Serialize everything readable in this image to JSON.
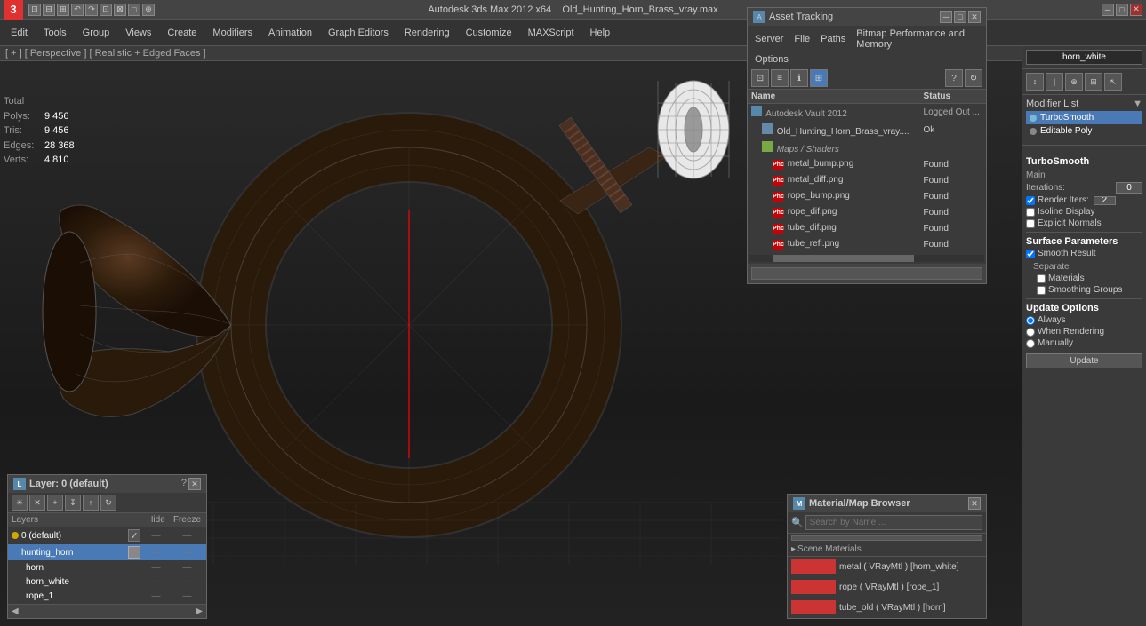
{
  "app": {
    "title": "Autodesk 3ds Max 2012 x64",
    "file": "Old_Hunting_Horn_Brass_vray.max",
    "logo": "3",
    "win_buttons": [
      "_",
      "□",
      "✕"
    ]
  },
  "menubar": {
    "items": [
      "Edit",
      "Tools",
      "Group",
      "Views",
      "Create",
      "Modifiers",
      "Animation",
      "Graph Editors",
      "Rendering",
      "Customize",
      "MAXScript",
      "Help"
    ]
  },
  "viewport": {
    "label": "[ + ] [ Perspective ] [ Realistic + Edged Faces ]",
    "stats": {
      "polys_label": "Polys:",
      "polys_val": "9 456",
      "tris_label": "Tris:",
      "tris_val": "9 456",
      "edges_label": "Edges:",
      "edges_val": "28 368",
      "verts_label": "Verts:",
      "verts_val": "4 810",
      "total_label": "Total"
    }
  },
  "right_panel": {
    "object_name": "horn_white",
    "modifier_list_label": "Modifier List",
    "modifiers": [
      {
        "name": "TurboSmooth",
        "active": true
      },
      {
        "name": "Editable Poly",
        "active": false
      }
    ],
    "turbosmooth": {
      "title": "TurboSmooth",
      "main_label": "Main",
      "iterations_label": "Iterations:",
      "iterations_val": "0",
      "render_iters_label": "Render Iters:",
      "render_iters_val": "2",
      "isoline_label": "Isoline Display",
      "explicit_label": "Explicit Normals",
      "surface_label": "Surface Parameters",
      "smooth_result_label": "Smooth Result",
      "separate_label": "Separate",
      "materials_label": "Materials",
      "smoothing_label": "Smoothing Groups",
      "update_options_label": "Update Options",
      "always_label": "Always",
      "when_rendering_label": "When Rendering",
      "manually_label": "Manually",
      "update_btn": "Update"
    }
  },
  "asset_panel": {
    "title": "Asset Tracking",
    "menu": [
      "Server",
      "File",
      "Paths",
      "Bitmap Performance and Memory",
      "Options"
    ],
    "toolbar_icons": [
      "grid",
      "list",
      "info",
      "refresh"
    ],
    "help_icon": "?",
    "columns": {
      "name": "Name",
      "status": "Status"
    },
    "rows": [
      {
        "icon": "vault",
        "indent": 0,
        "name": "Autodesk Vault 2012",
        "status": "Logged Out ..."
      },
      {
        "icon": "file",
        "indent": 1,
        "name": "Old_Hunting_Horn_Brass_vray....",
        "status": "Ok"
      },
      {
        "icon": "maps",
        "indent": 1,
        "name": "Maps / Shaders",
        "status": ""
      },
      {
        "icon": "phc",
        "indent": 2,
        "name": "metal_bump.png",
        "status": "Found"
      },
      {
        "icon": "phc",
        "indent": 2,
        "name": "metal_diff.png",
        "status": "Found"
      },
      {
        "icon": "phc",
        "indent": 2,
        "name": "rope_bump.png",
        "status": "Found"
      },
      {
        "icon": "phc",
        "indent": 2,
        "name": "rope_dif.png",
        "status": "Found"
      },
      {
        "icon": "phc",
        "indent": 2,
        "name": "tube_dif.png",
        "status": "Found"
      },
      {
        "icon": "phc",
        "indent": 2,
        "name": "tube_refl.png",
        "status": "Found"
      }
    ]
  },
  "layers_panel": {
    "title": "Layer: 0 (default)",
    "help": "?",
    "toolbar_btns": [
      "☀",
      "✕",
      "+",
      "↧",
      "↑",
      "↻"
    ],
    "columns": {
      "name": "Layers",
      "hide": "Hide",
      "freeze": "Freeze"
    },
    "layers": [
      {
        "indent": 0,
        "icon": "sun",
        "name": "0 (default)",
        "checked": true,
        "hide": "—",
        "freeze": "—"
      },
      {
        "indent": 0,
        "icon": "cube",
        "name": "hunting_horn",
        "checked": false,
        "hide": "—",
        "freeze": "—",
        "active": true
      },
      {
        "indent": 1,
        "icon": null,
        "name": "horn",
        "checked": false,
        "hide": "—",
        "freeze": "—"
      },
      {
        "indent": 1,
        "icon": null,
        "name": "horn_white",
        "checked": false,
        "hide": "—",
        "freeze": "—"
      },
      {
        "indent": 1,
        "icon": null,
        "name": "rope_1",
        "checked": false,
        "hide": "—",
        "freeze": "—"
      }
    ]
  },
  "mat_panel": {
    "title": "Material/Map Browser",
    "close": "✕",
    "search_placeholder": "Search by Name ...",
    "section_title": "Scene Materials",
    "materials": [
      {
        "name": "metal ( VRayMtl ) [horn_white]",
        "color": "#cc3333"
      },
      {
        "name": "rope ( VRayMtl ) [rope_1]",
        "color": "#cc3333"
      },
      {
        "name": "tube_old ( VRayMtl ) [horn]",
        "color": "#cc3333"
      }
    ]
  },
  "icons": {
    "search": "🔍",
    "close": "✕",
    "minimize": "─",
    "maximize": "□",
    "arrow_left": "◀",
    "arrow_right": "▶",
    "arrow_down": "▼",
    "arrow_up": "▲",
    "chevron": "›",
    "dot": "●"
  }
}
